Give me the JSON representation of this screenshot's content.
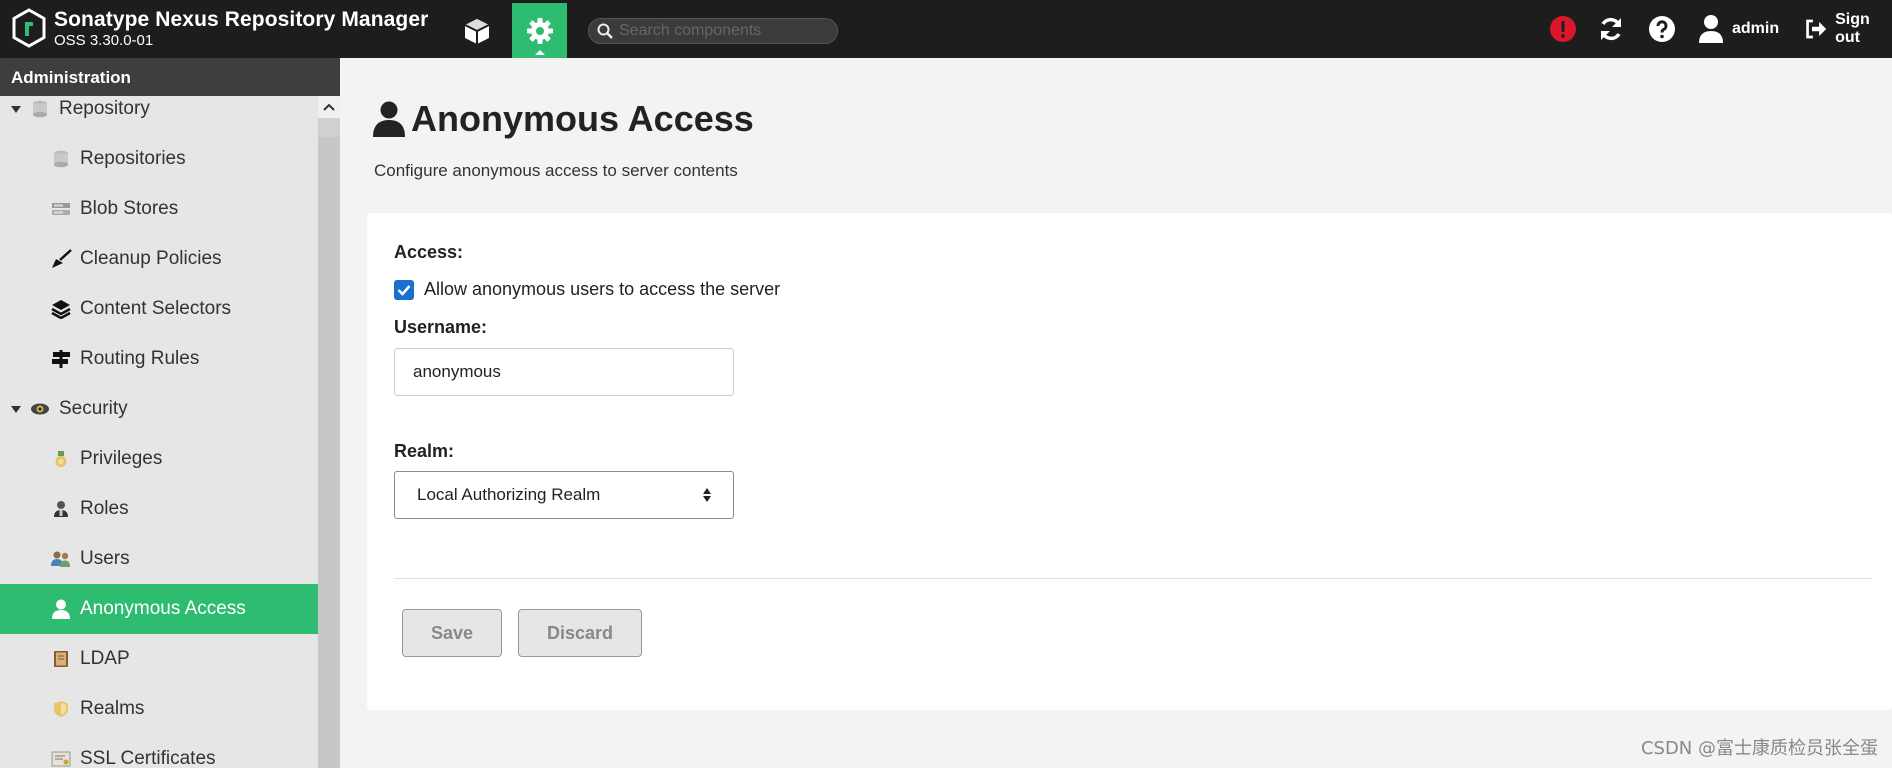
{
  "app": {
    "title": "Sonatype Nexus Repository Manager",
    "version": "OSS 3.30.0-01"
  },
  "header": {
    "search_placeholder": "Search components",
    "user_name": "admin",
    "signout_label": "Sign out"
  },
  "sidebar": {
    "title": "Administration",
    "items": [
      {
        "label": "Repository",
        "icon": "database-icon",
        "kind": "group"
      },
      {
        "label": "Repositories",
        "icon": "database-icon",
        "kind": "child"
      },
      {
        "label": "Blob Stores",
        "icon": "server-icon",
        "kind": "child"
      },
      {
        "label": "Cleanup Policies",
        "icon": "broom-icon",
        "kind": "child"
      },
      {
        "label": "Content Selectors",
        "icon": "layers-icon",
        "kind": "child"
      },
      {
        "label": "Routing Rules",
        "icon": "signpost-icon",
        "kind": "child"
      },
      {
        "label": "Security",
        "icon": "eye-icon",
        "kind": "group"
      },
      {
        "label": "Privileges",
        "icon": "medal-icon",
        "kind": "child"
      },
      {
        "label": "Roles",
        "icon": "role-icon",
        "kind": "child"
      },
      {
        "label": "Users",
        "icon": "users-icon",
        "kind": "child"
      },
      {
        "label": "Anonymous Access",
        "icon": "user-icon",
        "kind": "child",
        "active": true
      },
      {
        "label": "LDAP",
        "icon": "book-icon",
        "kind": "child"
      },
      {
        "label": "Realms",
        "icon": "shield-icon",
        "kind": "child"
      },
      {
        "label": "SSL Certificates",
        "icon": "certificate-icon",
        "kind": "child"
      }
    ]
  },
  "main": {
    "title": "Anonymous Access",
    "description": "Configure anonymous access to server contents",
    "access_label": "Access:",
    "checkbox_label": "Allow anonymous users to access the server",
    "checkbox_checked": true,
    "username_label": "Username:",
    "username_value": "anonymous",
    "realm_label": "Realm:",
    "realm_value": "Local Authorizing Realm",
    "save_label": "Save",
    "discard_label": "Discard"
  },
  "colors": {
    "accent": "#2ebd70",
    "topbar": "#1d1d1d",
    "alert": "#d9162b",
    "checkbox": "#1b6fd0"
  },
  "watermark": "CSDN @富士康质检员张全蛋"
}
